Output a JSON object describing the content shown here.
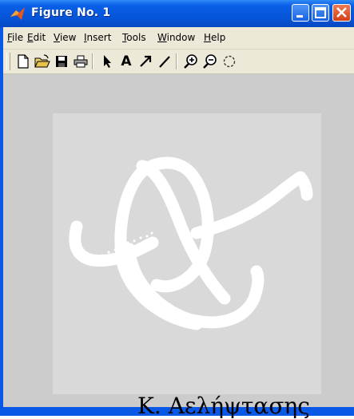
{
  "window": {
    "title": "Figure No. 1",
    "icon": "matlab-logo-icon"
  },
  "menu": {
    "items": [
      "File",
      "Edit",
      "View",
      "Insert",
      "Tools",
      "Window",
      "Help"
    ]
  },
  "toolbar": {
    "tools": [
      "new-figure-icon",
      "open-file-icon",
      "save-icon",
      "print-icon",
      "select-arrow-icon",
      "insert-text-icon",
      "insert-arrow-icon",
      "insert-line-icon",
      "zoom-in-icon",
      "zoom-out-icon",
      "rotate-icon"
    ],
    "text_tool_label": "A"
  },
  "caption": {
    "text": "Κ. Αελήψτασης"
  },
  "colors": {
    "titlebar": "#0553d6",
    "menubar": "#ece9d8",
    "figure_background": "#cccccc",
    "axes_background": "#d9d9d9",
    "stroke": "#ffffff"
  }
}
